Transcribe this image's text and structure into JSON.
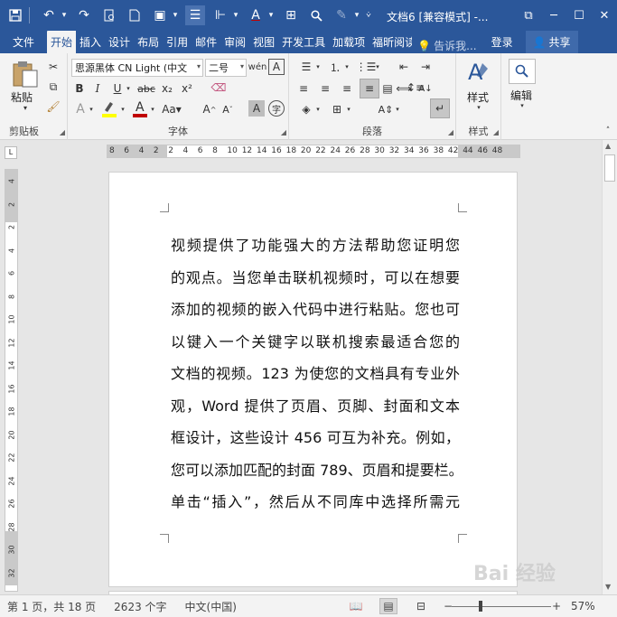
{
  "window": {
    "title": "文档6 [兼容模式] -..."
  },
  "tabs": [
    {
      "label": "文件"
    },
    {
      "label": "开始"
    },
    {
      "label": "插入"
    },
    {
      "label": "设计"
    },
    {
      "label": "布局"
    },
    {
      "label": "引用"
    },
    {
      "label": "邮件"
    },
    {
      "label": "审阅"
    },
    {
      "label": "视图"
    },
    {
      "label": "开发工具"
    },
    {
      "label": "加载项"
    },
    {
      "label": "福昕阅读"
    }
  ],
  "tell_me": "告诉我...",
  "login": "登录",
  "share": "共享",
  "ribbon": {
    "clipboard": {
      "label": "剪贴板",
      "paste": "粘贴"
    },
    "font": {
      "label": "字体",
      "font_name": "思源黑体 CN Light (中文",
      "font_size": "二号"
    },
    "paragraph": {
      "label": "段落"
    },
    "styles": {
      "label": "样式",
      "button": "样式"
    },
    "editing": {
      "button": "编辑"
    }
  },
  "ruler": {
    "h_ticks": [
      "8",
      "6",
      "4",
      "2",
      "2",
      "4",
      "6",
      "8",
      "10",
      "12",
      "14",
      "16",
      "18",
      "20",
      "22",
      "24",
      "26",
      "28",
      "30",
      "32",
      "34",
      "36",
      "38",
      "42",
      "44",
      "46",
      "48"
    ],
    "v_ticks": [
      "4",
      "2",
      "2",
      "4",
      "6",
      "8",
      "10",
      "12",
      "14",
      "16",
      "18",
      "20",
      "22",
      "24",
      "26",
      "28",
      "30",
      "32"
    ]
  },
  "document": {
    "lines": [
      "视频提供了功能强大的方法帮助您证明您",
      "的观点。当您单击联机视频时，可以在想要",
      "添加的视频的嵌入代码中进行粘贴。您也可",
      "以键入一个关键字以联机搜索最适合您的",
      "文档的视频。123 为使您的文档具有专业外",
      "观，Word 提供了页眉、页脚、封面和文本",
      "框设计，这些设计 456 可互为补充。例如，",
      "您可以添加匹配的封面 789、页眉和提要栏。",
      "单击“插入”，然后从不同库中选择所需元"
    ]
  },
  "status": {
    "page": "第 1 页，共 18 页",
    "words": "2623 个字",
    "language": "中文(中国)",
    "zoom": "57%"
  },
  "watermark": "Bai 经验",
  "colors": {
    "brand": "#2b579a",
    "font_color_red": "#c00000",
    "highlight_yellow": "#ffff00"
  }
}
